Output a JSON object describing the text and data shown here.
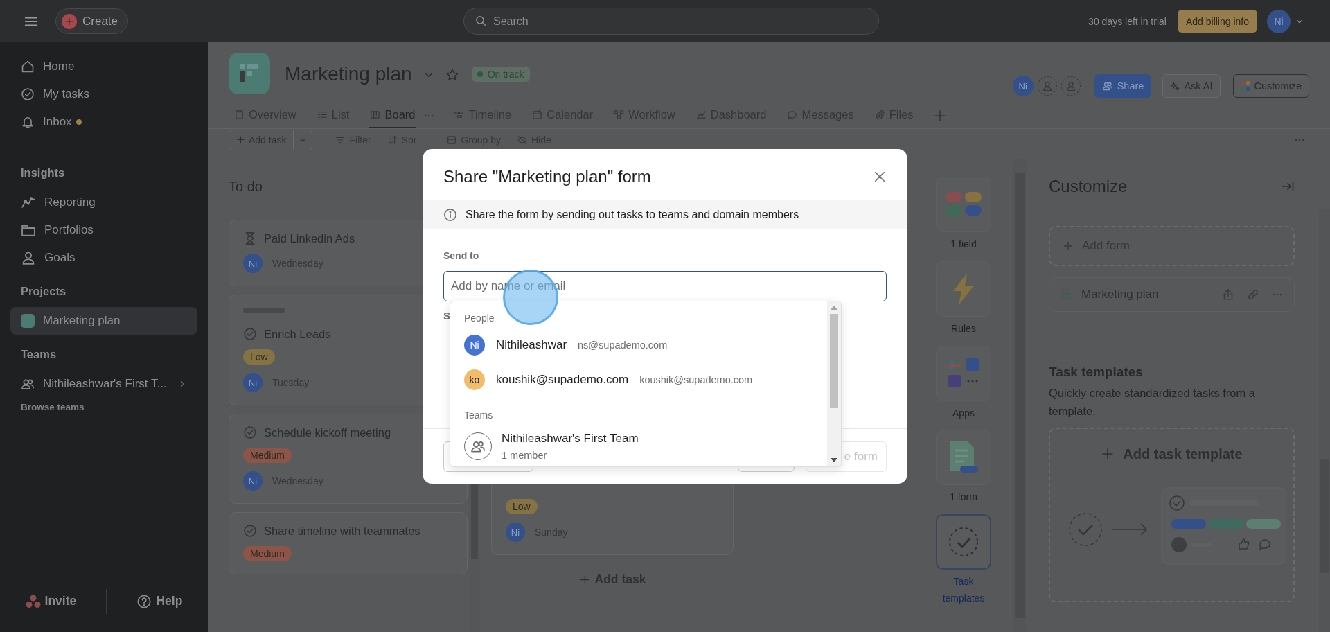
{
  "topbar": {
    "create": "Create",
    "search_placeholder": "Search",
    "trial": "30 days left in trial",
    "billing": "Add billing info",
    "avatar": "Ni"
  },
  "sidebar": {
    "nav": [
      {
        "label": "Home"
      },
      {
        "label": "My tasks"
      },
      {
        "label": "Inbox",
        "unread": true
      }
    ],
    "insights_heading": "Insights",
    "insights": [
      {
        "label": "Reporting"
      },
      {
        "label": "Portfolios"
      },
      {
        "label": "Goals"
      }
    ],
    "projects_heading": "Projects",
    "projects": [
      {
        "label": "Marketing plan",
        "selected": true
      }
    ],
    "teams_heading": "Teams",
    "teams": [
      {
        "label": "Nithileashwar's First T..."
      }
    ],
    "browse": "Browse teams",
    "invite": "Invite",
    "help": "Help"
  },
  "project": {
    "title": "Marketing plan",
    "status": "On track",
    "members": [
      {
        "kind": "user",
        "initials": "Ni"
      },
      {
        "kind": "placeholder"
      },
      {
        "kind": "placeholder"
      }
    ],
    "share": "Share",
    "ask_ai": "Ask AI",
    "customize": "Customize"
  },
  "tabs": [
    {
      "label": "Overview",
      "selected": false
    },
    {
      "label": "List",
      "selected": false
    },
    {
      "label": "Board",
      "selected": true
    },
    {
      "label": "Timeline",
      "selected": false
    },
    {
      "label": "Calendar",
      "selected": false
    },
    {
      "label": "Workflow",
      "selected": false
    },
    {
      "label": "Dashboard",
      "selected": false
    },
    {
      "label": "Messages",
      "selected": false
    },
    {
      "label": "Files",
      "selected": false
    }
  ],
  "toolbar": {
    "add_task": "Add task",
    "filter": "Filter",
    "sort": "Sor",
    "group": "Group by",
    "hide": "Hide"
  },
  "board": {
    "columns": [
      {
        "title": "To do",
        "cards": [
          {
            "kind": "milestone",
            "title": "Paid Linkedin Ads",
            "assignee": "Ni",
            "due": "Wednesday"
          },
          {
            "kind": "task",
            "placeholder_bar": true,
            "title": "Enrich Leads",
            "priority": {
              "label": "Low",
              "color": "#857343"
            },
            "assignee": "Ni",
            "due": "Tuesday"
          },
          {
            "kind": "task",
            "title": "Schedule kickoff meeting",
            "priority": {
              "label": "Medium",
              "color": "#8c5548"
            },
            "assignee": "Ni",
            "due": "Wednesday"
          },
          {
            "kind": "task",
            "title": "Share timeline with teammates",
            "priority": {
              "label": "Medium",
              "color": "#8c5548"
            }
          }
        ]
      },
      {
        "cards": [
          {
            "kind": "hidden",
            "priority": {
              "label": "Low",
              "color": "#857343"
            },
            "assignee": "Ni",
            "due": "Sunday"
          }
        ],
        "add_task": "Add task"
      }
    ]
  },
  "strip": [
    {
      "label": "1 field",
      "selected": false
    },
    {
      "label": "Rules",
      "selected": false
    },
    {
      "label": "Apps",
      "selected": false
    },
    {
      "label": "1 form",
      "selected": false
    },
    {
      "label": "Task templates",
      "selected": true
    }
  ],
  "customize": {
    "title": "Customize",
    "add_form": "Add form",
    "forms": [
      {
        "name": "Marketing plan"
      }
    ],
    "templates_heading": "Task templates",
    "templates_desc": "Quickly create standardized tasks from a template.",
    "add_template": "Add task template"
  },
  "modal": {
    "title": "Share \"Marketing plan\" form",
    "info": "Share the form by sending out tasks to teams and domain members",
    "send_to": "Send to",
    "placeholder": "Add by name or email",
    "section_label": "S",
    "right_button": "e form",
    "dropdown": {
      "people_heading": "People",
      "people": [
        {
          "initials": "Ni",
          "name": "Nithileashwar",
          "email": "ns@supademo.com",
          "color": "#4573d2"
        },
        {
          "initials": "ko",
          "name": "koushik@supademo.com",
          "email": "koushik@supademo.com",
          "color": "#f1bd6c"
        }
      ],
      "teams_heading": "Teams",
      "teams": [
        {
          "name": "Nithileashwar's First Team",
          "members": "1 member"
        }
      ]
    }
  }
}
